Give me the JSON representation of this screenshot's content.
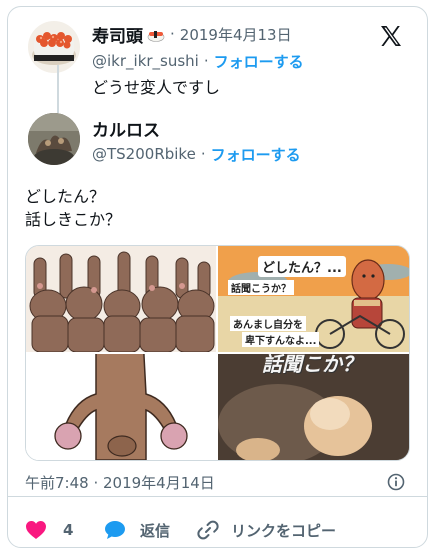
{
  "quoted": {
    "name": "寿司頭",
    "handle": "@ikr_ikr_sushi",
    "separator": "·",
    "date": "2019年4月13日",
    "follow": "フォローする",
    "text": "どうせ変人ですし"
  },
  "author": {
    "name": "カルロス",
    "handle": "@TS200Rbike",
    "separator": "·",
    "follow": "フォローする"
  },
  "tweet": {
    "line1": "どしたん？",
    "line2": "話しきこか？"
  },
  "media": {
    "comic_caption1": "どしたん？...",
    "comic_caption2": "話聞こうか？",
    "comic_caption3": "あんまし自分を",
    "comic_caption4": "卑下すんなよ...",
    "photo_caption": "話聞こか？"
  },
  "timestamp": "午前7:48 · 2019年4月14日",
  "actions": {
    "like_count": "4",
    "reply": "返信",
    "copy_link": "リンクをコピー"
  },
  "colors": {
    "accent": "#1d9bf0",
    "like": "#f91880",
    "text": "#0f1419",
    "muted": "#536471"
  }
}
